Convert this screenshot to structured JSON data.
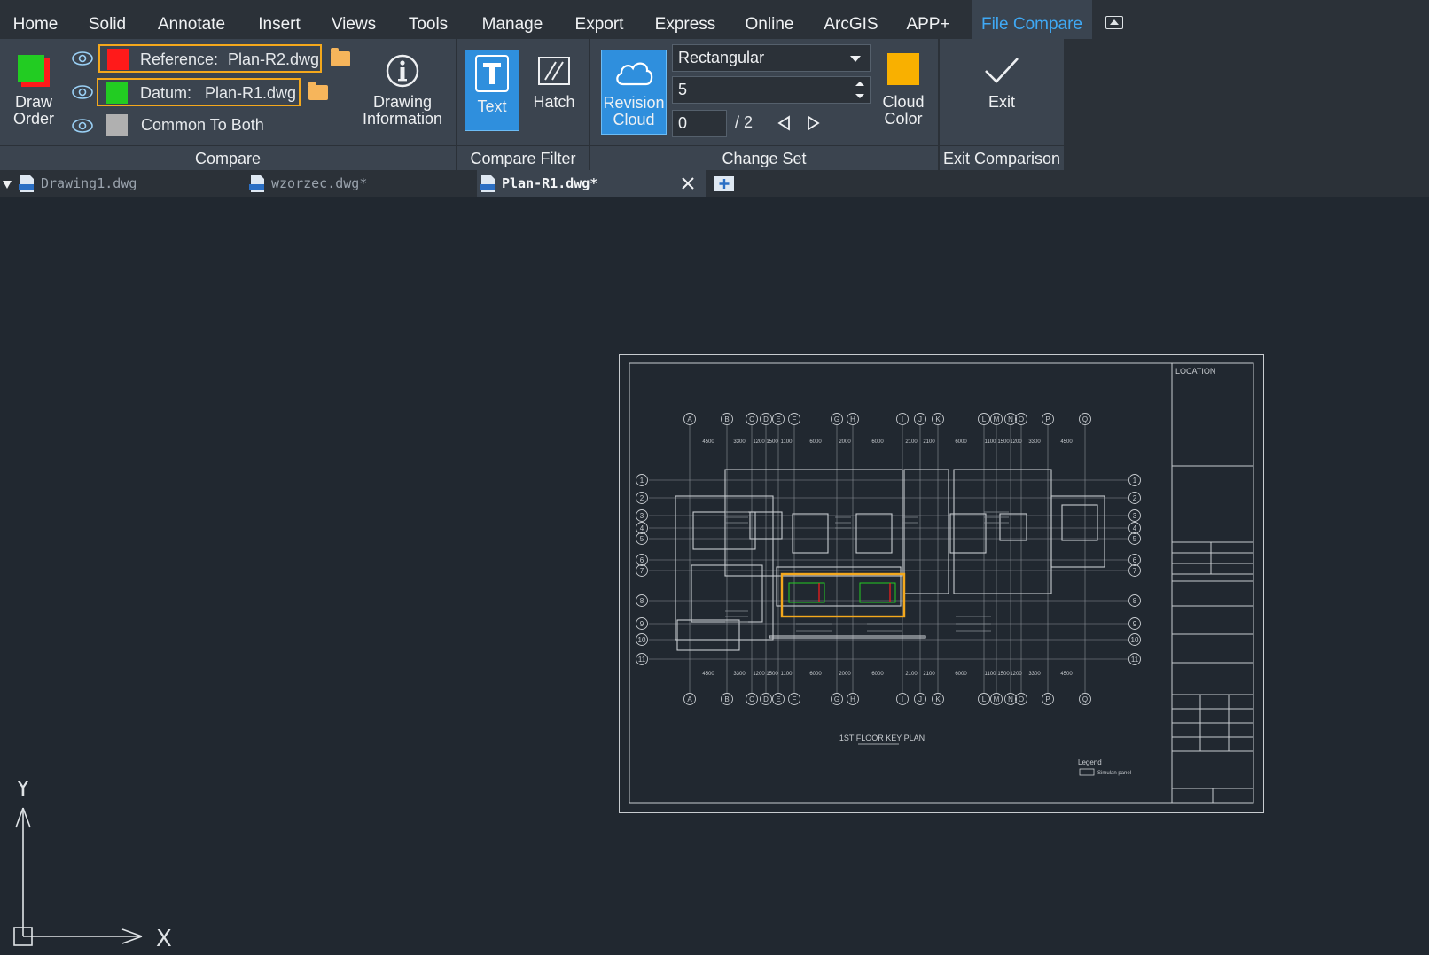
{
  "menu": {
    "tabs": [
      "Home",
      "Solid",
      "Annotate",
      "Insert",
      "Views",
      "Tools",
      "Manage",
      "Export",
      "Express",
      "Online",
      "ArcGIS",
      "APP+",
      "File Compare"
    ],
    "active": "File Compare"
  },
  "compare": {
    "draw_order_label": "Draw\nOrder",
    "reference_label": "Reference:",
    "reference_file": "Plan-R2.dwg",
    "datum_label": "Datum:",
    "datum_file": "Plan-R1.dwg",
    "common_label": "Common To Both",
    "drawing_info_label": "Drawing\nInformation",
    "title": "Compare"
  },
  "compare_filter": {
    "text_label": "Text",
    "hatch_label": "Hatch",
    "title": "Compare Filter"
  },
  "change_set": {
    "revision_cloud_label": "Revision\nCloud",
    "shape_value": "Rectangular",
    "arc_value": "5",
    "current_index": "0",
    "total": "/ 2",
    "cloud_color_label": "Cloud\nColor",
    "title": "Change Set"
  },
  "exit": {
    "exit_label": "Exit",
    "title": "Exit Comparison"
  },
  "documents": [
    {
      "name": "Drawing1.dwg"
    },
    {
      "name": "wzorzec.dwg*"
    },
    {
      "name": "Plan-R1.dwg*"
    }
  ],
  "drawing": {
    "location_label": "LOCATION",
    "plan_title": "1ST FLOOR KEY PLAN",
    "legend_label": "Legend",
    "legend_item": "Simulan panel",
    "col_labels": [
      "A",
      "B",
      "C",
      "D",
      "E",
      "F",
      "G",
      "H",
      "I",
      "J",
      "K",
      "L",
      "M",
      "N",
      "O",
      "P",
      "Q"
    ],
    "row_labels": [
      "1",
      "2",
      "3",
      "4",
      "5",
      "6",
      "7",
      "8",
      "9",
      "10",
      "11"
    ],
    "dims_top": [
      "4500",
      "3300",
      "1200",
      "1500",
      "1100",
      "6000",
      "2000",
      "6000",
      "2100",
      "2100",
      "6000",
      "1100",
      "1500",
      "1200",
      "3300",
      "4500"
    ]
  },
  "axes": {
    "x": "X",
    "y": "Y"
  },
  "colors": {
    "reference": "#ff1a1a",
    "datum": "#22cc22",
    "common": "#b0b0b0",
    "cloud": "#f9b000",
    "accent": "#3fa9f5",
    "highlight": "#f4a81c"
  }
}
